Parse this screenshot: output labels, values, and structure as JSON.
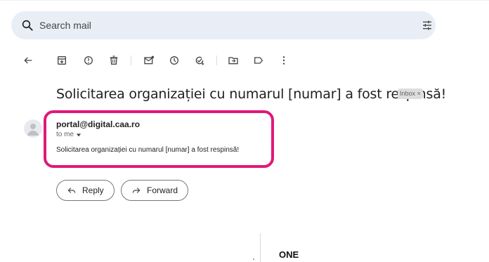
{
  "search": {
    "placeholder": "Search mail"
  },
  "toolbar": {
    "icons": [
      "back-arrow-icon",
      "archive-icon",
      "report-spam-icon",
      "delete-icon",
      "mark-unread-icon",
      "snooze-icon",
      "add-task-icon",
      "move-to-icon",
      "label-icon",
      "more-vert-icon"
    ]
  },
  "email": {
    "subject": "Solicitarea organizației cu numarul [numar] a fost respinsă!",
    "label_chip": "Inbox ×",
    "sender": "portal@digital.caa.ro",
    "to": "to me",
    "body": "Solicitarea organizației cu numarul [numar] a fost respinsă!"
  },
  "actions": {
    "reply": "Reply",
    "forward": "Forward"
  },
  "footer": {
    "text": "ONE"
  },
  "colors": {
    "highlight": "#e0187a",
    "search_bg": "#e9eef6"
  }
}
